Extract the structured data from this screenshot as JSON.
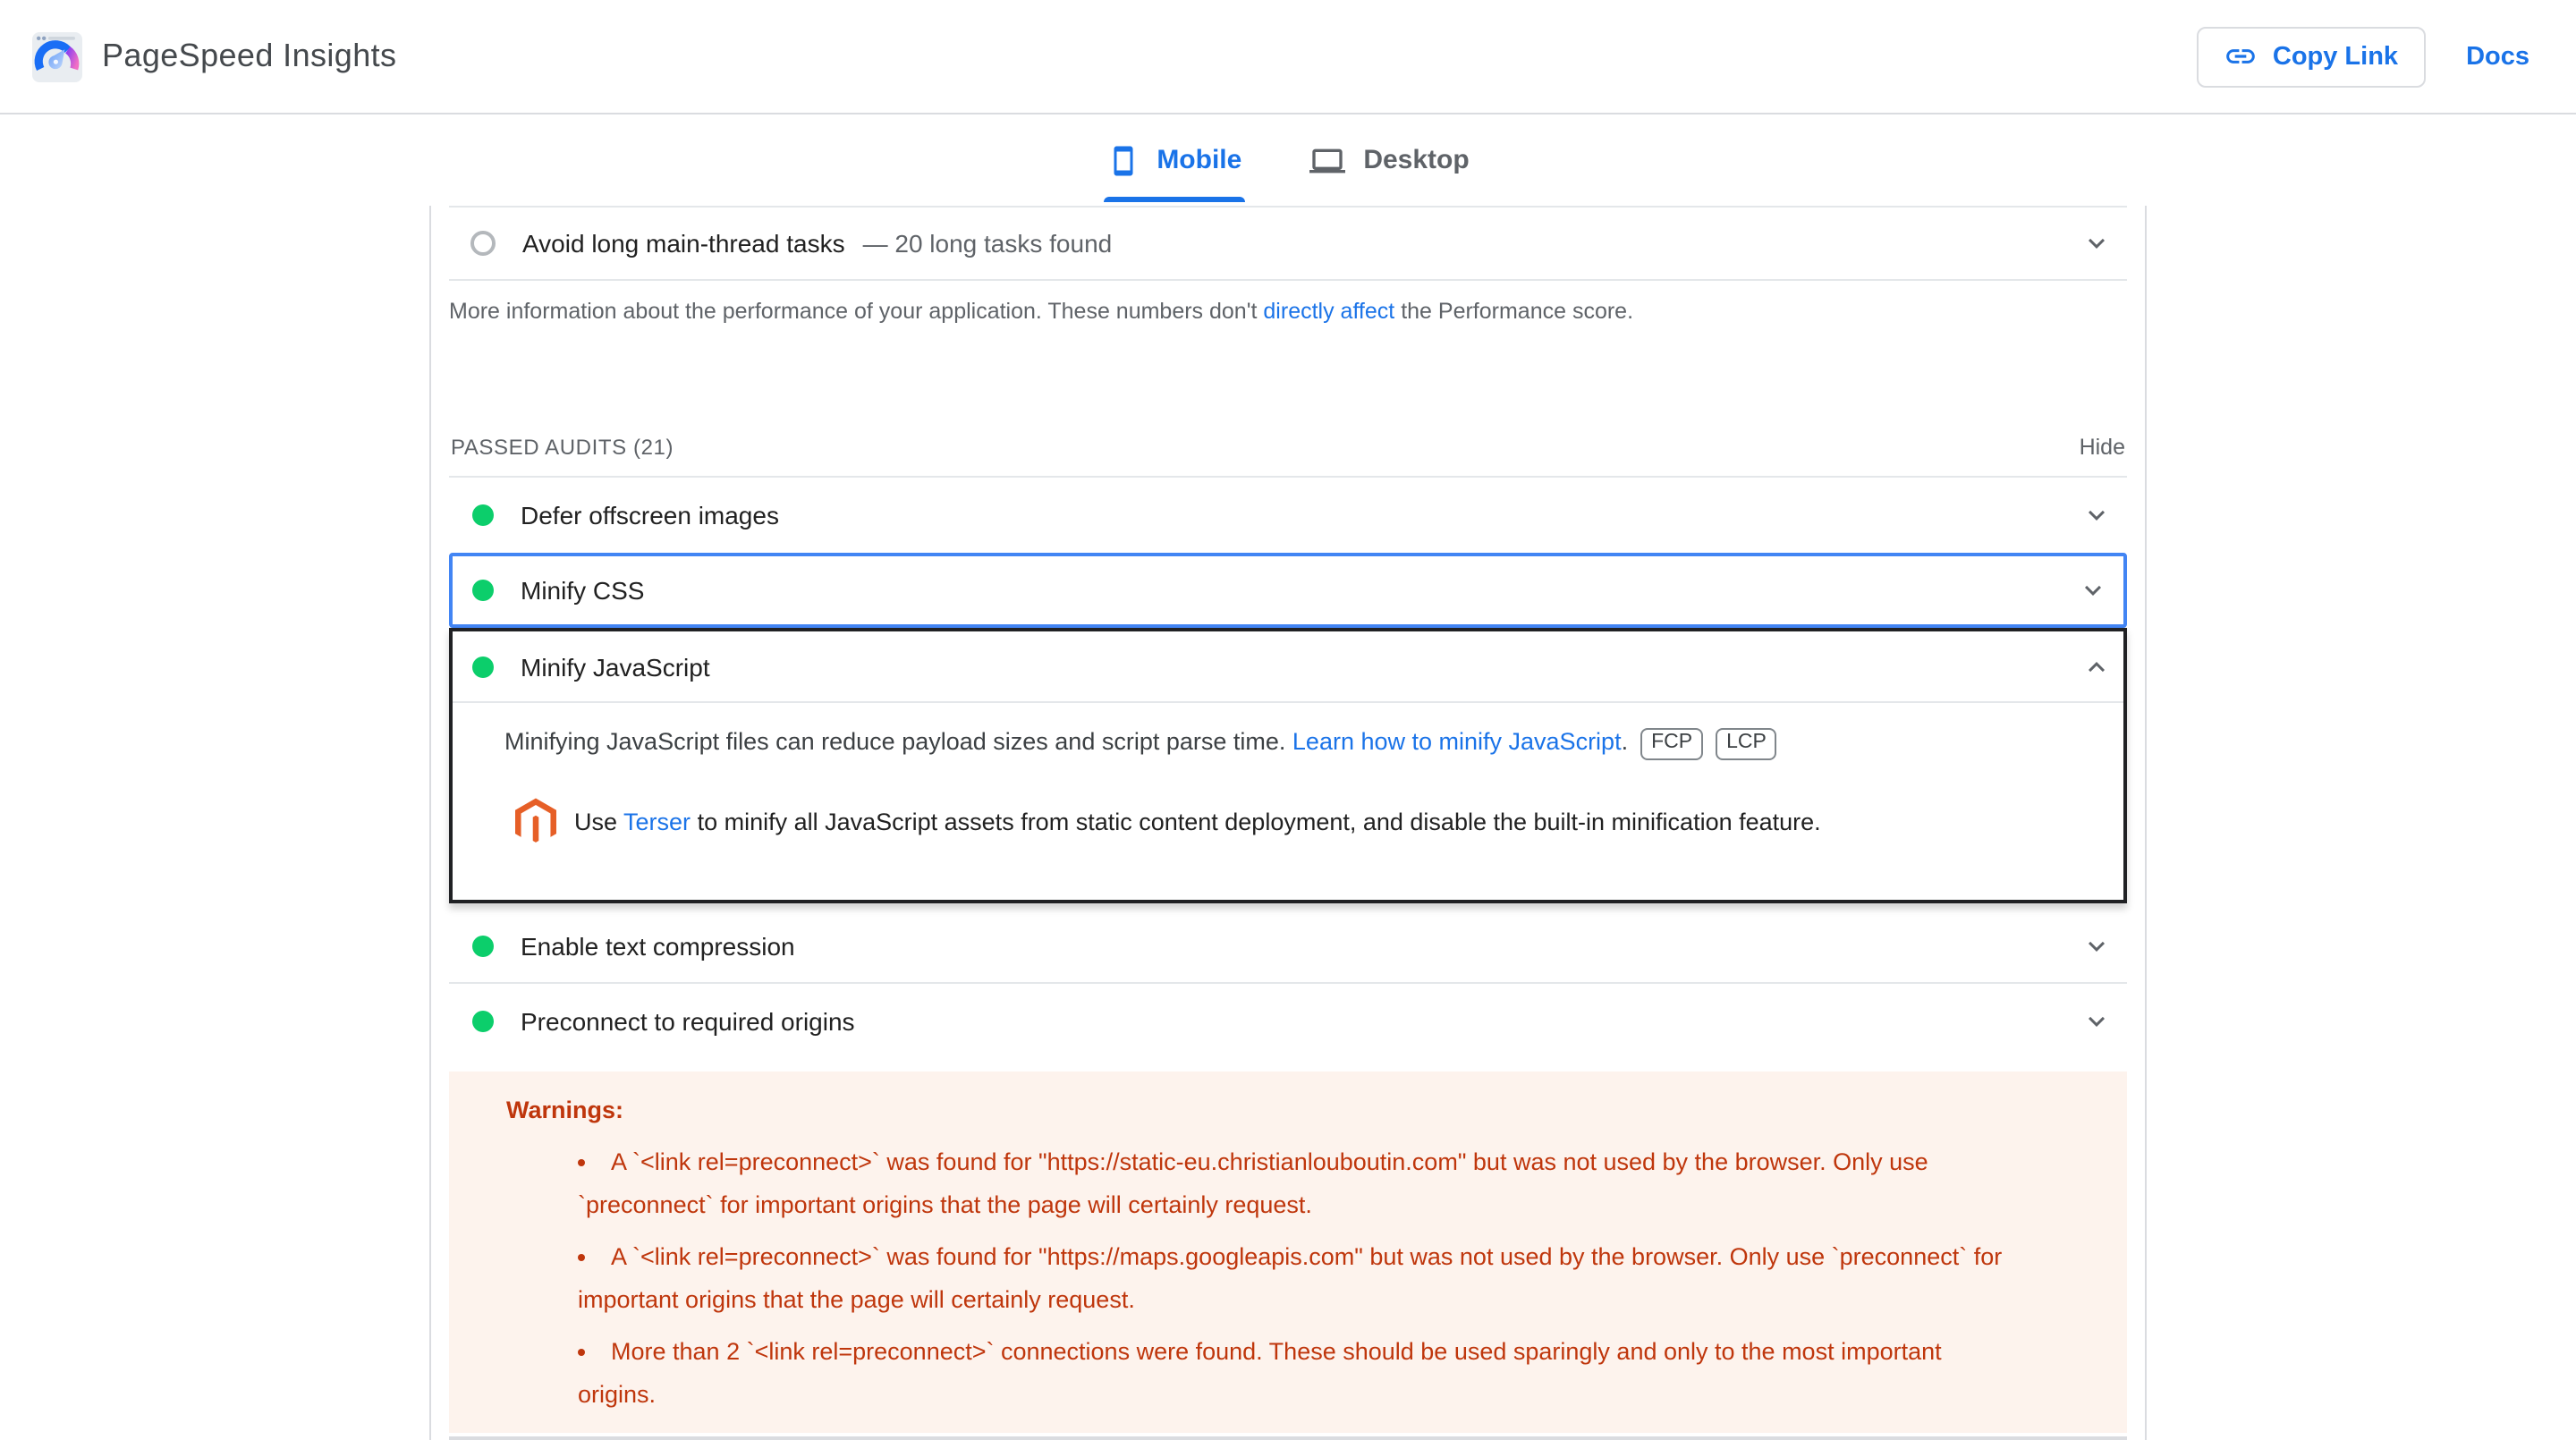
{
  "colors": {
    "accent_blue": "#1a73e8",
    "focus_blue": "#4285f4",
    "pass_green": "#0cce6b",
    "warning_text_red": "#bf360c",
    "warning_bg": "#fdf3ed",
    "border_gray": "#dadce0",
    "text_dark": "#212121",
    "text_gray": "#5f6368",
    "magento_orange": "#e65f27"
  },
  "header": {
    "title": "PageSpeed Insights",
    "copy_link": "Copy Link",
    "docs": "Docs"
  },
  "tabs": {
    "mobile": "Mobile",
    "desktop": "Desktop"
  },
  "diagnostics": {
    "row_title": "Avoid long main-thread tasks",
    "row_detail": "—  20 long tasks found",
    "info_prefix": "More information about the performance of your application. These numbers don't ",
    "info_link": "directly affect",
    "info_suffix": " the Performance score."
  },
  "passed_audits": {
    "heading": "PASSED AUDITS (21)",
    "hide": "Hide",
    "defer_title": "Defer offscreen images",
    "minify_css_title": "Minify CSS",
    "minify_js_title": "Minify JavaScript",
    "enable_compression_title": "Enable text compression",
    "preconnect_title": "Preconnect to required origins"
  },
  "minify_js": {
    "description": "Minifying JavaScript files can reduce payload sizes and script parse time. ",
    "description_link": "Learn how to minify JavaScript",
    "description_period": ".",
    "chips": [
      "FCP",
      "LCP"
    ],
    "stack_prefix": "Use ",
    "stack_link": "Terser",
    "stack_suffix": " to minify all JavaScript assets from static content deployment, and disable the built-in minification feature."
  },
  "warnings": {
    "heading": "Warnings:",
    "items": [
      "A `<link rel=preconnect>` was found for \"https://static-eu.christianlouboutin.com\" but was not used by the browser. Only use `preconnect` for important origins that the page will certainly request.",
      "A `<link rel=preconnect>` was found for \"https://maps.googleapis.com\" but was not used by the browser. Only use `preconnect` for important origins that the page will certainly request.",
      "More than 2 `<link rel=preconnect>` connections were found. These should be used sparingly and only to the most important origins."
    ]
  }
}
